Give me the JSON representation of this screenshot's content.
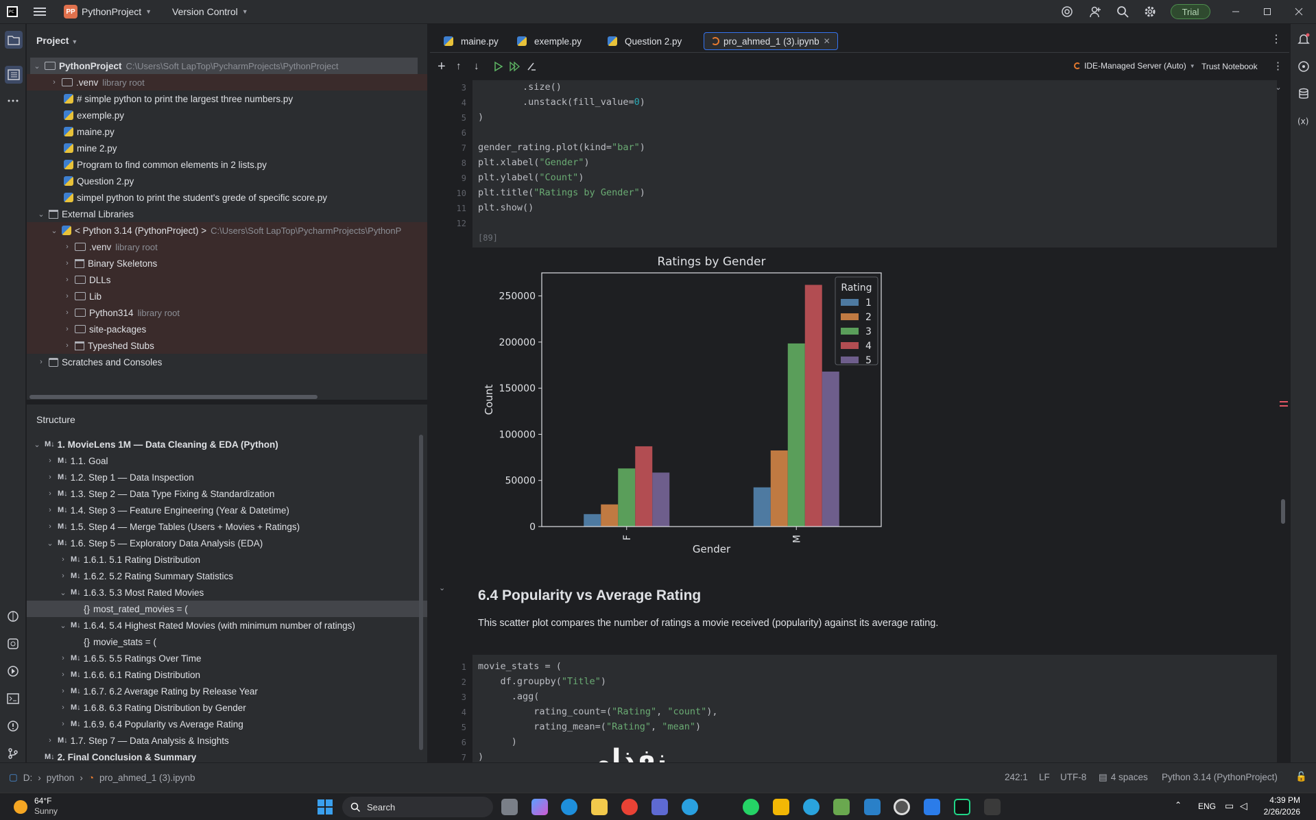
{
  "titlebar": {
    "project_badge": "PP",
    "project_name": "PythonProject",
    "vcs_menu": "Version Control",
    "trial_label": "Trial"
  },
  "project_panel": {
    "title": "Project",
    "root_name": "PythonProject",
    "root_path": "C:\\Users\\Soft LapTop\\PycharmProjects\\PythonProject",
    "items": [
      {
        "label": ".venv",
        "hint": "library root"
      },
      {
        "label": "# simple python to print the largest three numbers.py"
      },
      {
        "label": "exemple.py"
      },
      {
        "label": "maine.py"
      },
      {
        "label": "mine 2.py"
      },
      {
        "label": "Program to find common elements in 2 lists.py"
      },
      {
        "label": "Question 2.py"
      },
      {
        "label": "simpel python to print the student's grede of specific score.py"
      }
    ],
    "external_libraries": "External Libraries",
    "python_sdk": "< Python 3.14 (PythonProject) >",
    "python_sdk_path": "C:\\Users\\Soft LapTop\\PycharmProjects\\PythonP",
    "sdk_items": [
      {
        "label": ".venv",
        "hint": "library root"
      },
      {
        "label": "Binary Skeletons"
      },
      {
        "label": "DLLs"
      },
      {
        "label": "Lib"
      },
      {
        "label": "Python314",
        "hint": "library root"
      },
      {
        "label": "site-packages"
      },
      {
        "label": "Typeshed Stubs"
      }
    ],
    "scratches": "Scratches and Consoles"
  },
  "structure_panel": {
    "title": "Structure",
    "md_badge": "M↓",
    "items": [
      "1. MovieLens 1M — Data Cleaning & EDA (Python)",
      "1.1. Goal",
      "1.2. Step 1 — Data Inspection",
      "1.3. Step 2 — Data Type Fixing & Standardization",
      "1.4. Step 3 — Feature Engineering (Year & Datetime)",
      "1.5. Step 4 — Merge Tables (Users + Movies + Ratings)",
      "1.6. Step 5 — Exploratory Data Analysis (EDA)",
      "1.6.1. 5.1 Rating Distribution",
      "1.6.2. 5.2 Rating Summary Statistics",
      "1.6.3. 5.3 Most Rated Movies",
      "most_rated_movies = (",
      "1.6.4. 5.4 Highest Rated Movies (with minimum number of ratings)",
      "movie_stats = (",
      "1.6.5. 5.5 Ratings Over Time",
      "1.6.6. 6.1 Rating Distribution",
      "1.6.7. 6.2 Average Rating by Release Year",
      "1.6.8. 6.3 Rating Distribution by Gender",
      "1.6.9. 6.4 Popularity vs Average Rating",
      "1.7. Step 7 — Data Analysis & Insights",
      "2. Final Conclusion & Summary"
    ]
  },
  "tabs": [
    "maine.py",
    "exemple.py",
    "Question 2.py",
    "pro_ahmed_1 (3).ipynb"
  ],
  "notebook_bar": {
    "server": "IDE-Managed Server (Auto)",
    "trust": "Trust Notebook",
    "check_count": "1"
  },
  "cell1": {
    "line_numbers": [
      "3",
      "4",
      "5",
      "6",
      "7",
      "8",
      "9",
      "10",
      "11",
      "12"
    ],
    "lines": [
      [
        "        .size()",
        ""
      ],
      [
        "        .unstack(fill_value=",
        "0",
        ")"
      ],
      [
        ")"
      ],
      [
        ""
      ],
      [
        "gender_rating.plot(kind=",
        "\"bar\"",
        ")"
      ],
      [
        "plt.xlabel(",
        "\"Gender\"",
        ")"
      ],
      [
        "plt.ylabel(",
        "\"Count\"",
        ")"
      ],
      [
        "plt.title(",
        "\"Ratings by Gender\"",
        ")"
      ],
      [
        "plt.show()"
      ],
      [
        ""
      ]
    ],
    "exec_count": "[89]"
  },
  "chart_data": {
    "type": "bar",
    "title": "Ratings by Gender",
    "xlabel": "Gender",
    "ylabel": "Count",
    "categories": [
      "F",
      "M"
    ],
    "ylim": [
      0,
      275000
    ],
    "yticks": [
      0,
      50000,
      100000,
      150000,
      200000,
      250000
    ],
    "legend_title": "Rating",
    "legend_position": "top-right",
    "series": [
      {
        "name": "1",
        "color": "#4e7aa1",
        "values": [
          13500,
          42500
        ]
      },
      {
        "name": "2",
        "color": "#c07a42",
        "values": [
          24000,
          82500
        ]
      },
      {
        "name": "3",
        "color": "#5a9e5a",
        "values": [
          63000,
          198500
        ]
      },
      {
        "name": "4",
        "color": "#b24d52",
        "values": [
          87000,
          262000
        ]
      },
      {
        "name": "5",
        "color": "#6e5e8c",
        "values": [
          58500,
          168000
        ]
      }
    ]
  },
  "markdown_cell": {
    "heading": "6.4 Popularity vs Average Rating",
    "text": "This scatter plot compares the number of ratings a movie received (popularity) against its average rating."
  },
  "cell2": {
    "line_numbers": [
      "1",
      "2",
      "3",
      "4",
      "5",
      "6",
      "7"
    ],
    "lines": [
      [
        "movie_stats = ("
      ],
      [
        "    df.groupby(",
        "\"Title\"",
        ")"
      ],
      [
        "      .agg("
      ],
      [
        "          rating_count=(",
        "\"Rating\"",
        ", ",
        "\"count\"",
        "),"
      ],
      [
        "          rating_mean=(",
        "\"Rating\"",
        ", ",
        "\"mean\"",
        ")"
      ],
      [
        "      )"
      ],
      [
        ")"
      ]
    ]
  },
  "status_bar": {
    "breadcrumb": [
      "D:",
      "python",
      "pro_ahmed_1 (3).ipynb"
    ],
    "position": "242:1",
    "line_ending": "LF",
    "encoding": "UTF-8",
    "indent": "4 spaces",
    "interpreter": "Python 3.14 (PythonProject)"
  },
  "taskbar": {
    "weather_temp": "64°F",
    "weather_desc": "Sunny",
    "search": "Search",
    "lang": "ENG",
    "time": "4:39 PM",
    "date": "2/26/2026"
  },
  "watermark": "نفذلي nafezly.com"
}
